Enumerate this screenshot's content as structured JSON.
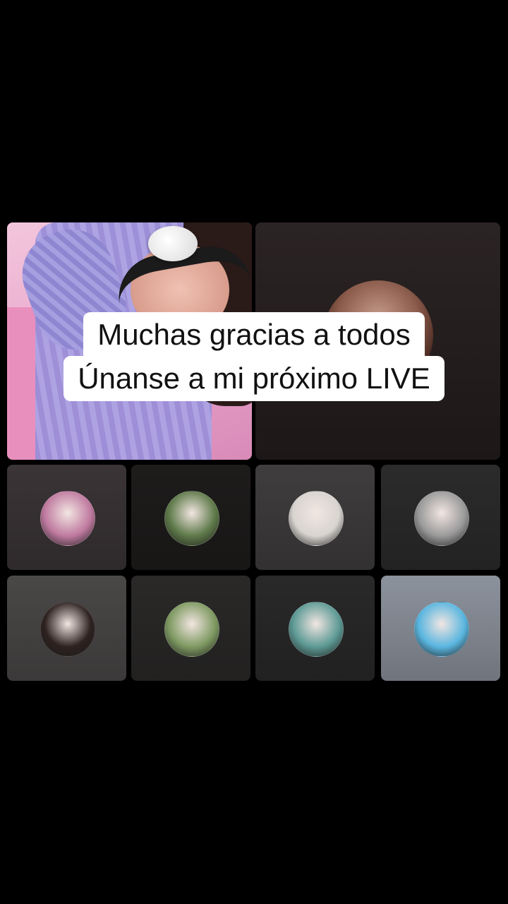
{
  "caption": {
    "line1": "Muchas gracias a todos",
    "line2": "Únanse a mi próximo LIVE"
  },
  "tiles": {
    "host": {
      "icon": "host-video-feed"
    },
    "guest": {
      "icon": "guest-avatar"
    }
  },
  "participants": [
    {
      "name": "participant-1",
      "bg": "#3a3436",
      "avatar_color": "#c07ba0"
    },
    {
      "name": "participant-2",
      "bg": "#1e1c1b",
      "avatar_color": "#5f7a4a"
    },
    {
      "name": "participant-3",
      "bg": "#3f3d3e",
      "avatar_color": "#d8d4d0"
    },
    {
      "name": "participant-4",
      "bg": "#2c2b2c",
      "avatar_color": "#9a9a9a"
    },
    {
      "name": "participant-5",
      "bg": "#4a4747",
      "avatar_color": "#2d2220"
    },
    {
      "name": "participant-6",
      "bg": "#2a2928",
      "avatar_color": "#7f9a62"
    },
    {
      "name": "participant-7",
      "bg": "#2a292a",
      "avatar_color": "#5e9a95"
    },
    {
      "name": "participant-8",
      "bg": "#8c929c",
      "avatar_color": "#5ab6e0"
    }
  ]
}
